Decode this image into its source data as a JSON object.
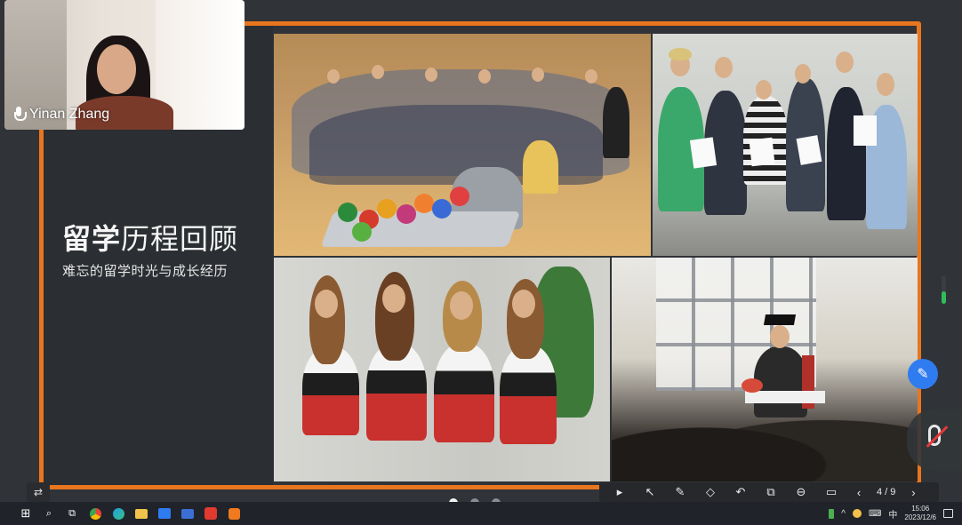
{
  "participant": {
    "name": "Yinan Zhang"
  },
  "slide": {
    "title_bold": "留学",
    "title_rest": "历程回顾",
    "subtitle": "难忘的留学时光与成长经历"
  },
  "toolbar": {
    "swap": "⇄",
    "play": "▸",
    "pointer": "↖",
    "pen": "✎",
    "eraser": "◇",
    "undo": "↶",
    "copy": "⧉",
    "zoom": "⊖",
    "screen": "▭",
    "prev": "‹",
    "page": "4 / 9",
    "next": "›"
  },
  "pagination": {
    "total_dots": 3,
    "active_index": 0
  },
  "taskbar": {
    "start": "⊞",
    "search": "⌕",
    "taskview": "⧉",
    "tray_arrow": "^",
    "keyboard": "⌨",
    "ime": "中",
    "time": "15:06",
    "date": "2023/12/6"
  },
  "colors": {
    "accent": "#e8761e",
    "side_button": "#2f7bf0"
  }
}
